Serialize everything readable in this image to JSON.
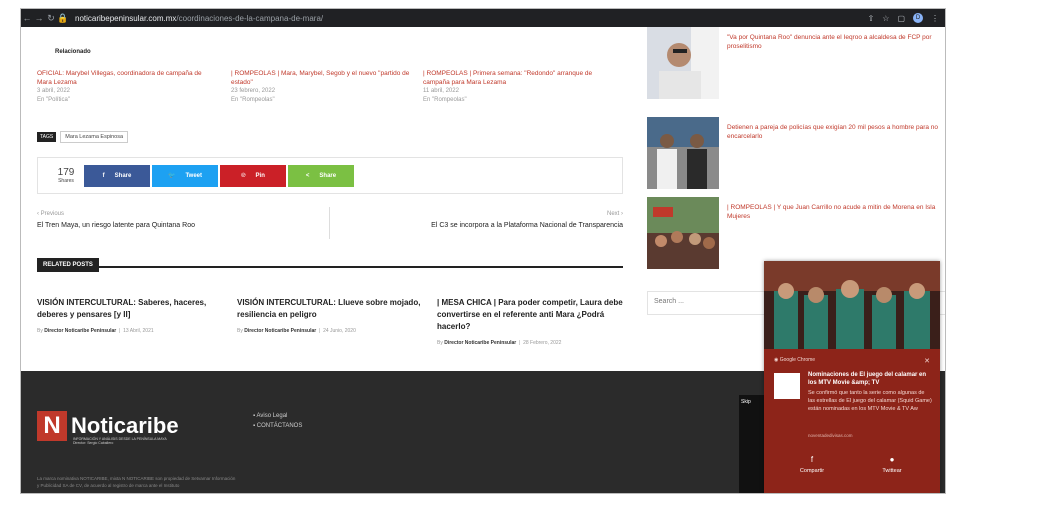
{
  "browser": {
    "url_domain": "noticaribepeninsular.com.mx",
    "url_path": "/coordinaciones-de-la-campana-de-mara/",
    "profile_initial": "D"
  },
  "related": {
    "heading": "Relacionado",
    "items": [
      {
        "title": "OFICIAL: Marybel Villegas, coordinadora de campaña de Mara Lezama",
        "date": "3 abril, 2022",
        "category": "En \"Política\""
      },
      {
        "title": "| ROMPEOLAS | Mara, Marybel, Segob y el nuevo \"partido de estado\"",
        "date": "23 febrero, 2022",
        "category": "En \"Rompeolas\""
      },
      {
        "title": "| ROMPEOLAS | Primera semana: \"Redondo\" arranque de campaña para Mara Lezama",
        "date": "11 abril, 2022",
        "category": "En \"Rompeolas\""
      }
    ]
  },
  "tags": {
    "label": "TAGS",
    "value": "Mara Lezama Espinosa"
  },
  "share": {
    "count": "179",
    "count_label": "Shares",
    "buttons": [
      {
        "label": "Share",
        "icon": "f",
        "color": "#3b5998"
      },
      {
        "label": "Tweet",
        "icon": "🐦",
        "color": "#1da1f2"
      },
      {
        "label": "Pin",
        "icon": "℗",
        "color": "#cb2027"
      },
      {
        "label": "Share",
        "icon": "<",
        "color": "#7bc043"
      }
    ]
  },
  "nav": {
    "prev_label": "‹ Previous",
    "prev_title": "El Tren Maya, un riesgo latente para Quintana Roo",
    "next_label": "Next ›",
    "next_title": "El C3 se incorpora a la Plataforma Nacional de Transparencia"
  },
  "related_posts": {
    "heading": "RELATED POSTS",
    "posts": [
      {
        "title": "VISIÓN INTERCULTURAL: Saberes, haceres, deberes y pensares [y II]",
        "by": "By",
        "author": "Director Noticaribe Peninsular",
        "date": "13 Abril, 2021"
      },
      {
        "title": "VISIÓN INTERCULTURAL: Llueve sobre mojado, resiliencia en peligro",
        "by": "By",
        "author": "Director Noticaribe Peninsular",
        "date": "24 Junio, 2020"
      },
      {
        "title": "| MESA CHICA | Para poder competir, Laura debe convertirse en el referente anti Mara ¿Podrá hacerlo?",
        "by": "By",
        "author": "Director Noticaribe Peninsular",
        "date": "28 Febrero, 2022"
      }
    ]
  },
  "sidebar": {
    "items": [
      {
        "title": "\"Va por Quintana Roo\" denuncia ante el Ieqroo a alcaldesa de FCP por proselitismo"
      },
      {
        "title": "Detienen a pareja de policías que exigían 20 mil pesos a hombre para no encarcelarlo"
      },
      {
        "title": "| ROMPEOLAS | Y que Juan Carrillo no acude a mitin de Morena en Isla Mujeres"
      }
    ],
    "search_placeholder": "Search ..."
  },
  "footer": {
    "logo_letter": "N",
    "logo_name": "Noticaribe",
    "logo_tagline": "INFORMACIÓN Y ANÁLISIS DESDE LA PENÍNSULA MAYA",
    "logo_sub": "Director: Sergio Caballero",
    "links": [
      "Aviso Legal",
      "CONTÁCTANOS"
    ],
    "legal": "La marca nominativa NOTICARIBE, mixta N NOTICARIBE son propiedad de Setvamar Información y Publicidad SA de CV, de acuerdo al registro de marca ante el Instituto"
  },
  "notification": {
    "source": "Google Chrome",
    "title": "Nominaciones de El juego del calamar en los MTV Movie &amp; TV",
    "body": "Se confirmó que tanto la serie como algunas de las estrellas de El juego del calamar (Squid Game) están nominadas en los MTV Movie & TV Aw",
    "domain": "noventadedivisas.com",
    "actions": [
      {
        "label": "Compartir",
        "icon": "f"
      },
      {
        "label": "Twittear",
        "icon": "●"
      }
    ],
    "skip_label": "Skip"
  }
}
